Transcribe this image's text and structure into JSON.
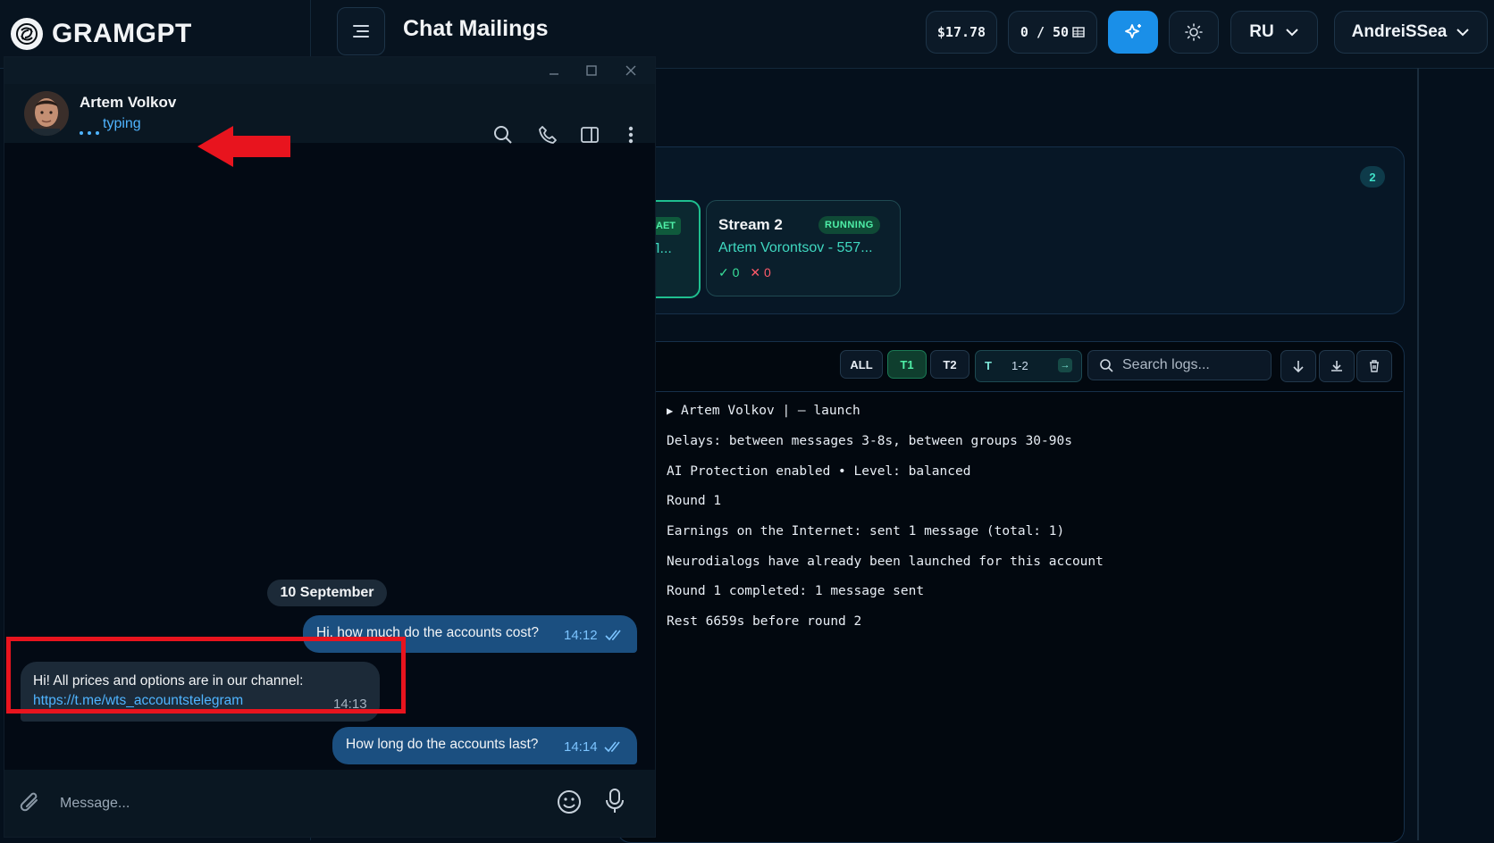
{
  "app": {
    "brand": "GRAMGPT",
    "page_title": "Chat Mailings",
    "balance": "$17.78",
    "quota": "0 / 50",
    "language": "RU",
    "user": "AndreiSSea"
  },
  "streams": {
    "count": "2",
    "stream1": {
      "badge": "AET",
      "sub": "Л..."
    },
    "stream2": {
      "title": "Stream 2",
      "status": "RUNNING",
      "account": "Artem Vorontsov - 557...",
      "ok": "0",
      "err": "0"
    }
  },
  "logs": {
    "filters": {
      "all": "ALL",
      "t1": "T1",
      "t2": "T2"
    },
    "range_prefix": "T",
    "range": "1-2",
    "search_placeholder": "Search logs...",
    "head": "Artem Volkov  | — launch",
    "lines": [
      "Delays: between messages 3-8s, between groups 30-90s",
      "AI Protection enabled • Level: balanced",
      "Round 1",
      "Earnings on the Internet: sent 1 message (total: 1)",
      "Neurodialogs have already been launched for this account",
      "Round 1 completed: 1 message sent",
      "Rest 6659s before round 2"
    ]
  },
  "chat": {
    "contact_name": "Artem Volkov",
    "contact_status": "typing",
    "date_separator": "10 September",
    "messages": [
      {
        "text": "Hi, how much do the accounts cost?",
        "time": "14:12"
      },
      {
        "text": "Hi! All prices and options are in our channel:",
        "link": "https://t.me/wts_accountstelegram",
        "time": "14:13"
      },
      {
        "text": "How long do the accounts last?",
        "time": "14:14"
      }
    ],
    "input_placeholder": "Message..."
  },
  "colors": {
    "accent": "#1a8fe8",
    "annotation_red": "#e8141e",
    "outgoing_bubble": "#1b4f80",
    "incoming_bubble": "#1c2a38",
    "success": "#4ff0a8"
  }
}
